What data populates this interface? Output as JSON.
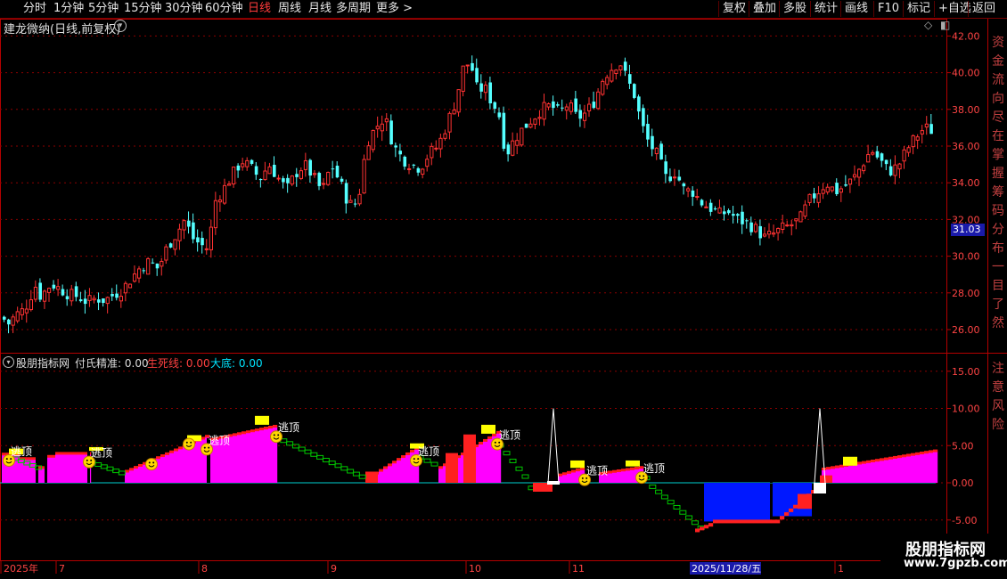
{
  "toolbar": {
    "periods": [
      "分时",
      "1分钟",
      "5分钟",
      "15分钟",
      "30分钟",
      "60分钟",
      "日线",
      "周线",
      "月线",
      "多周期",
      "更多 >"
    ],
    "active_period": "日线",
    "right_buttons": [
      "复权",
      "叠加",
      "多股",
      "统计",
      "画线",
      "F10",
      "标记",
      "+自选",
      "返回"
    ]
  },
  "main_chart": {
    "title": "建龙微纳(日线,前复权)",
    "yticks": [
      "42.00",
      "40.00",
      "38.00",
      "36.00",
      "34.00",
      "32.00",
      "30.00",
      "28.00",
      "26.00"
    ],
    "current_price": "31.03",
    "right_column_text": "资金流向尽在掌握筹码分布一目了然"
  },
  "indicator": {
    "name": "股朋指标网",
    "fields": [
      {
        "label": "付氏精准:",
        "value": "0.00",
        "color": "#dcdcdc"
      },
      {
        "label": "生死线:",
        "value": "0.00",
        "color": "#ff4040"
      },
      {
        "label": "大底:",
        "value": "0.00",
        "color": "#00e5ff"
      }
    ],
    "yticks": [
      "15.00",
      "10.00",
      "5.00",
      "0.00",
      "-5.00"
    ],
    "signal_label": "逃顶",
    "right_column_text": "注意风险"
  },
  "date_axis": {
    "labels": [
      "2025年",
      "7",
      "8",
      "9",
      "10",
      "11",
      "1"
    ],
    "cursor_date": "2025/11/28/五"
  },
  "watermark": {
    "title": "股朋指标网",
    "url": "www.7gpzb.com"
  },
  "colors": {
    "up": "#ff3232",
    "down": "#54ffff",
    "grid": "#8b0000",
    "axis": "#b40000",
    "pink": "#ff00ff",
    "blue": "#0018ff",
    "green": "#00c800",
    "yellow": "#ffff00"
  },
  "chart_data": [
    {
      "type": "candlestick",
      "title": "建龙微纳(日线,前复权)",
      "ylim": [
        25.0,
        43.0
      ],
      "close_path": [
        [
          0,
          26.9
        ],
        [
          6,
          26.2
        ],
        [
          16,
          26.8
        ],
        [
          26,
          27.1
        ],
        [
          38,
          28.4
        ],
        [
          44,
          27.8
        ],
        [
          56,
          28.5
        ],
        [
          66,
          28.2
        ],
        [
          76,
          27.9
        ],
        [
          86,
          27.8
        ],
        [
          96,
          27.5
        ],
        [
          106,
          27.7
        ],
        [
          116,
          27.6
        ],
        [
          126,
          27.9
        ],
        [
          136,
          28.2
        ],
        [
          146,
          28.8
        ],
        [
          156,
          29.4
        ],
        [
          166,
          29.7
        ],
        [
          176,
          29.3
        ],
        [
          186,
          30.5
        ],
        [
          196,
          31.2
        ],
        [
          206,
          32.0
        ],
        [
          214,
          31.0
        ],
        [
          224,
          30.6
        ],
        [
          232,
          30.4
        ],
        [
          240,
          33.0
        ],
        [
          250,
          33.7
        ],
        [
          260,
          34.5
        ],
        [
          270,
          35.2
        ],
        [
          280,
          34.8
        ],
        [
          290,
          34.2
        ],
        [
          300,
          35.0
        ],
        [
          310,
          34.3
        ],
        [
          320,
          33.6
        ],
        [
          330,
          34.5
        ],
        [
          340,
          35.0
        ],
        [
          350,
          34.3
        ],
        [
          360,
          33.5
        ],
        [
          370,
          35.0
        ],
        [
          380,
          34.0
        ],
        [
          390,
          32.8
        ],
        [
          400,
          32.9
        ],
        [
          410,
          36.2
        ],
        [
          420,
          37.0
        ],
        [
          430,
          37.6
        ],
        [
          440,
          36.0
        ],
        [
          450,
          35.3
        ],
        [
          460,
          35.0
        ],
        [
          470,
          34.8
        ],
        [
          480,
          35.6
        ],
        [
          490,
          36.0
        ],
        [
          500,
          37.2
        ],
        [
          510,
          38.5
        ],
        [
          518,
          40.2
        ],
        [
          526,
          40.6
        ],
        [
          534,
          39.0
        ],
        [
          542,
          39.2
        ],
        [
          550,
          38.4
        ],
        [
          558,
          37.8
        ],
        [
          566,
          35.5
        ],
        [
          576,
          36.4
        ],
        [
          586,
          37.0
        ],
        [
          596,
          37.5
        ],
        [
          606,
          38.0
        ],
        [
          616,
          38.2
        ],
        [
          626,
          37.8
        ],
        [
          636,
          38.3
        ],
        [
          646,
          37.5
        ],
        [
          656,
          37.8
        ],
        [
          666,
          38.5
        ],
        [
          676,
          39.8
        ],
        [
          686,
          40.3
        ],
        [
          694,
          40.6
        ],
        [
          702,
          39.6
        ],
        [
          710,
          38.8
        ],
        [
          718,
          37.2
        ],
        [
          726,
          36.2
        ],
        [
          736,
          35.5
        ],
        [
          746,
          34.2
        ],
        [
          756,
          34.6
        ],
        [
          766,
          33.6
        ],
        [
          776,
          33.5
        ],
        [
          786,
          32.9
        ],
        [
          796,
          32.6
        ],
        [
          806,
          32.3
        ],
        [
          816,
          32.4
        ],
        [
          826,
          32.0
        ],
        [
          836,
          31.8
        ],
        [
          846,
          31.5
        ],
        [
          856,
          31.0
        ],
        [
          866,
          31.2
        ],
        [
          876,
          31.5
        ],
        [
          886,
          31.7
        ],
        [
          896,
          32.0
        ],
        [
          906,
          33.0
        ],
        [
          916,
          33.5
        ],
        [
          926,
          34.0
        ],
        [
          936,
          33.5
        ],
        [
          946,
          33.8
        ],
        [
          956,
          34.2
        ],
        [
          966,
          35.0
        ],
        [
          976,
          35.8
        ],
        [
          986,
          35.2
        ],
        [
          996,
          34.6
        ],
        [
          1006,
          34.9
        ],
        [
          1016,
          35.8
        ],
        [
          1026,
          36.5
        ],
        [
          1036,
          37.0
        ],
        [
          1046,
          36.8
        ]
      ]
    },
    {
      "type": "indicator",
      "name": "股朋指标网",
      "ylim": [
        -7.0,
        17.0
      ],
      "series": [
        {
          "name": "付氏精准",
          "values": [
            0.0,
            0.0,
            0.0
          ]
        },
        {
          "name": "生死线",
          "values": [
            0.0,
            0.0,
            0.0
          ]
        },
        {
          "name": "大底",
          "values": [
            0.0,
            0.0,
            0.0
          ]
        }
      ]
    }
  ]
}
